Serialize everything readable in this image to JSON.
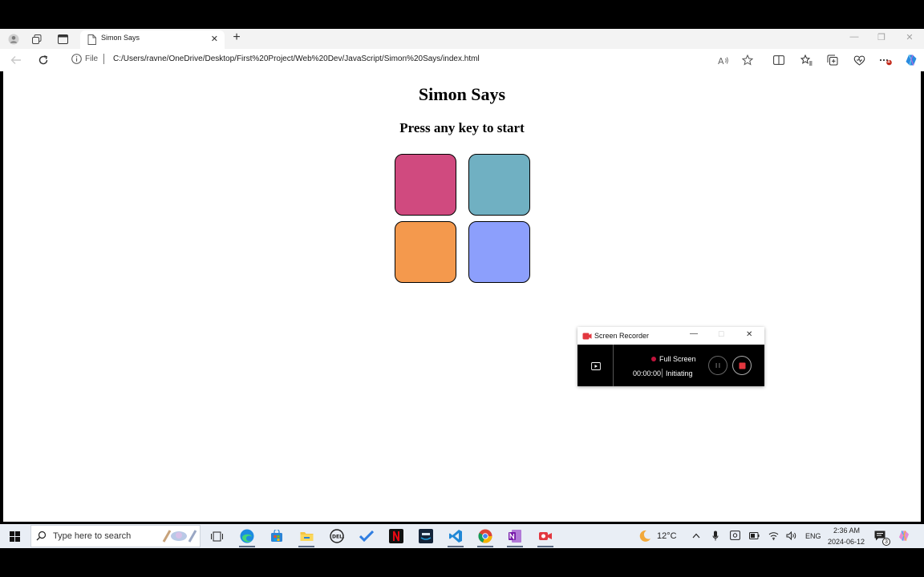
{
  "browser": {
    "tab_title": "Simon Says",
    "address_scheme": "File",
    "address_url": "C:/Users/ravne/OneDrive/Desktop/First%20Project/Web%20Dev/JavaScript/Simon%20Says/index.html",
    "notification_badge": "1"
  },
  "page": {
    "title": "Simon Says",
    "subtitle": "Press any key to start",
    "buttons": [
      {
        "id": "red",
        "color": "#d04a7f"
      },
      {
        "id": "teal",
        "color": "#70b0c2"
      },
      {
        "id": "orange",
        "color": "#f4994d"
      },
      {
        "id": "blue",
        "color": "#8c9ffc"
      }
    ]
  },
  "recorder": {
    "title": "Screen Recorder",
    "mode": "Full Screen",
    "time": "00:00:00",
    "status": "Initiating"
  },
  "taskbar": {
    "search_placeholder": "Type here to search",
    "weather": "12°C",
    "language": "ENG",
    "time": "2:36 AM",
    "date": "2024-06-12",
    "notification_count": "3"
  }
}
